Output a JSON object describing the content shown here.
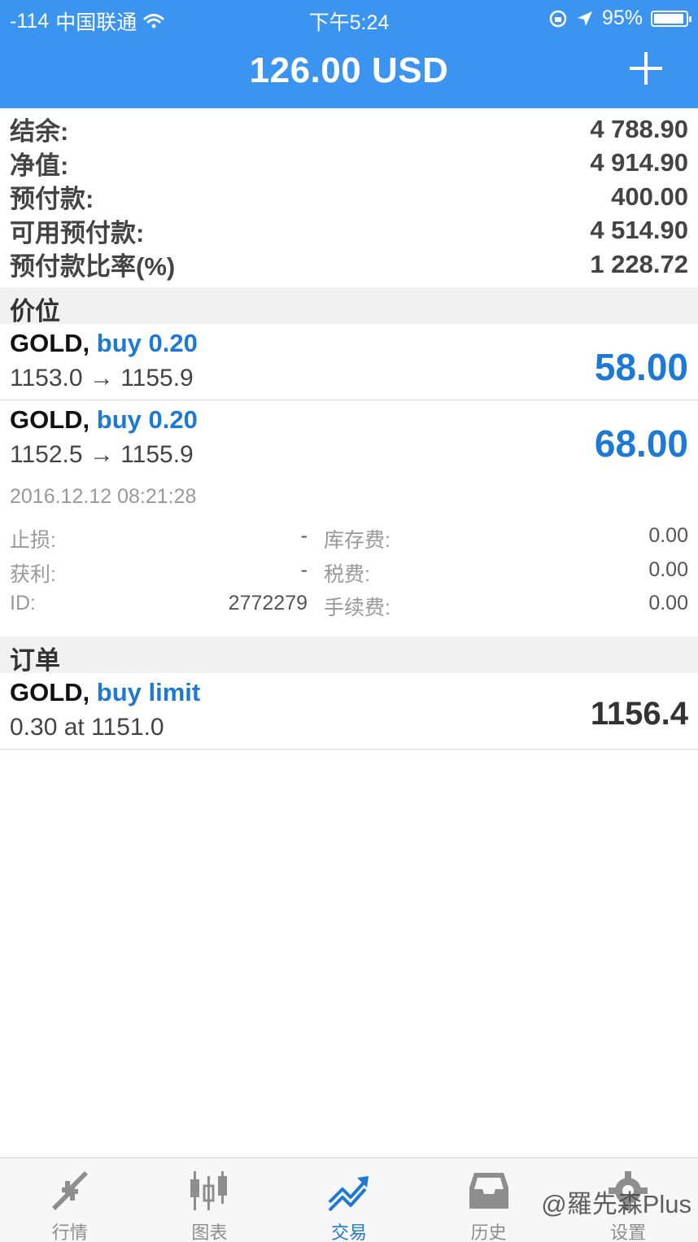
{
  "status_bar": {
    "signal": "-114",
    "carrier": "中国联通",
    "time": "下午5:24",
    "battery": "95%"
  },
  "nav": {
    "title": "126.00 USD"
  },
  "account": [
    {
      "label": "结余:",
      "value": "4 788.90"
    },
    {
      "label": "净值:",
      "value": "4 914.90"
    },
    {
      "label": "预付款:",
      "value": "400.00"
    },
    {
      "label": "可用预付款:",
      "value": "4 514.90"
    },
    {
      "label": "预付款比率(%)",
      "value": "1 228.72"
    }
  ],
  "positions_header": "价位",
  "positions": [
    {
      "symbol": "GOLD,",
      "direction": "buy 0.20",
      "prices": "1153.0 → 1155.9",
      "profit": "58.00"
    },
    {
      "symbol": "GOLD,",
      "direction": "buy 0.20",
      "prices": "1152.5 → 1155.9",
      "profit": "68.00"
    }
  ],
  "details": {
    "date": "2016.12.12 08:21:28",
    "rows": [
      {
        "l1": "止损:",
        "v1": "-",
        "l2": "库存费:",
        "v2": "0.00"
      },
      {
        "l1": "获利:",
        "v1": "-",
        "l2": "税费:",
        "v2": "0.00"
      },
      {
        "l1": "ID:",
        "v1": "2772279",
        "l2": "手续费:",
        "v2": "0.00"
      }
    ]
  },
  "orders_header": "订单",
  "orders": [
    {
      "symbol": "GOLD,",
      "direction": "buy limit",
      "prices": "0.30 at 1151.0",
      "price": "1156.4"
    }
  ],
  "tabs": [
    {
      "label": "行情",
      "icon": "quotes-arrows-icon"
    },
    {
      "label": "图表",
      "icon": "candlestick-chart-icon"
    },
    {
      "label": "交易",
      "icon": "trade-trend-icon",
      "active": true
    },
    {
      "label": "历史",
      "icon": "history-inbox-icon"
    },
    {
      "label": "设置",
      "icon": "gear-icon"
    }
  ],
  "watermark": "@羅先森Plus",
  "colors": {
    "accent": "#3b95f0",
    "link_blue": "#1e79d6"
  }
}
